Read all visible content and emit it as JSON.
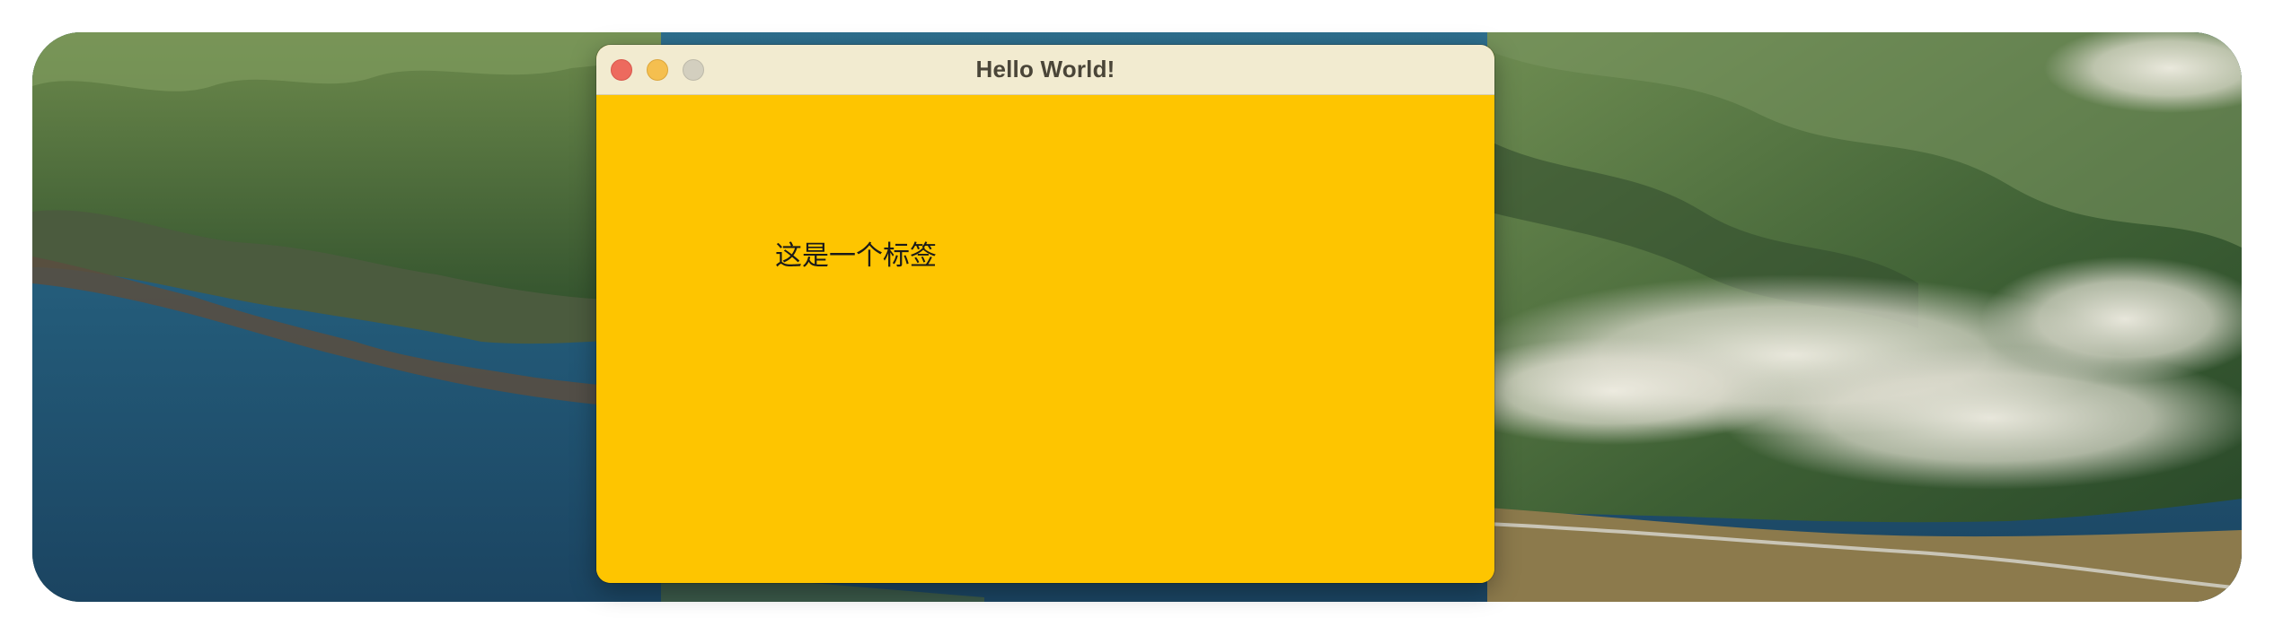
{
  "window": {
    "title": "Hello World!",
    "background_color": "#fec500",
    "titlebar_color": "#f2ebd0"
  },
  "traffic_lights": {
    "close_color": "#ed6a5e",
    "minimize_color": "#f5bf4f",
    "zoom_color": "#d3cfbf",
    "zoom_enabled": false
  },
  "content": {
    "label_text": "这是一个标签"
  },
  "desktop": {
    "wallpaper": "coastal mountains with sea and low clouds"
  }
}
